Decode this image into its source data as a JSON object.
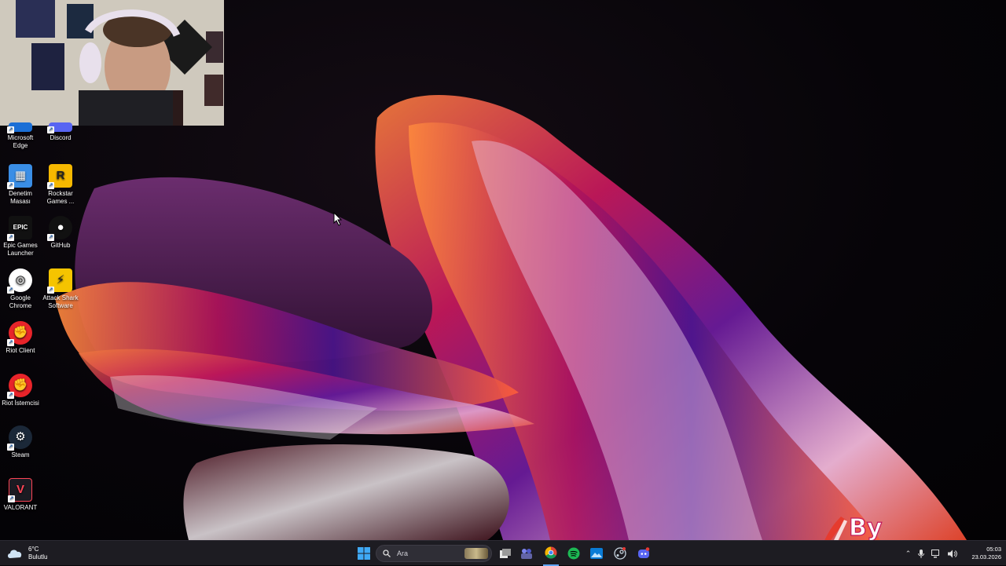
{
  "desktop": {
    "icons": [
      {
        "label": "Microsoft Edge",
        "icon": "edge-icon",
        "color": "#1b6fd6"
      },
      {
        "label": "Discord",
        "icon": "discord-icon",
        "color": "#5865f2"
      },
      {
        "label": "Denetim Masası",
        "icon": "control-panel-icon",
        "color": "#3a8ee6"
      },
      {
        "label": "Rockstar Games ...",
        "icon": "rockstar-icon",
        "color": "#f6b800"
      },
      {
        "label": "Epic Games Launcher",
        "icon": "epic-games-icon",
        "color": "#111111"
      },
      {
        "label": "GitHub",
        "icon": "github-icon",
        "color": "#111111"
      },
      {
        "label": "Google Chrome",
        "icon": "chrome-icon",
        "color": "#ffffff"
      },
      {
        "label": "Attack Shark Software",
        "icon": "attack-shark-icon",
        "color": "#f5c400"
      },
      {
        "label": "Riot Client",
        "icon": "riot-icon",
        "color": "#e8242a"
      },
      {
        "label": "Riot İstemcisi",
        "icon": "riot-icon",
        "color": "#e8242a"
      },
      {
        "label": "Steam",
        "icon": "steam-icon",
        "color": "#1b2838"
      },
      {
        "label": "VALORANT",
        "icon": "valorant-icon",
        "color": "#fd4556"
      }
    ]
  },
  "taskbar": {
    "weather": {
      "temp": "6°C",
      "condition": "Bulutlu"
    },
    "search_placeholder": "Ara",
    "apps": [
      "start-icon",
      "file-explorer-icon",
      "teams-icon",
      "chrome-icon",
      "spotify-icon",
      "photos-icon",
      "steam-icon",
      "discord-icon"
    ],
    "clock": {
      "time": "05:03",
      "date": "23.03.2026"
    }
  },
  "watermark": {
    "text": "By"
  },
  "colors": {
    "taskbar": "#1d1c22",
    "accent": "#0078d4"
  }
}
